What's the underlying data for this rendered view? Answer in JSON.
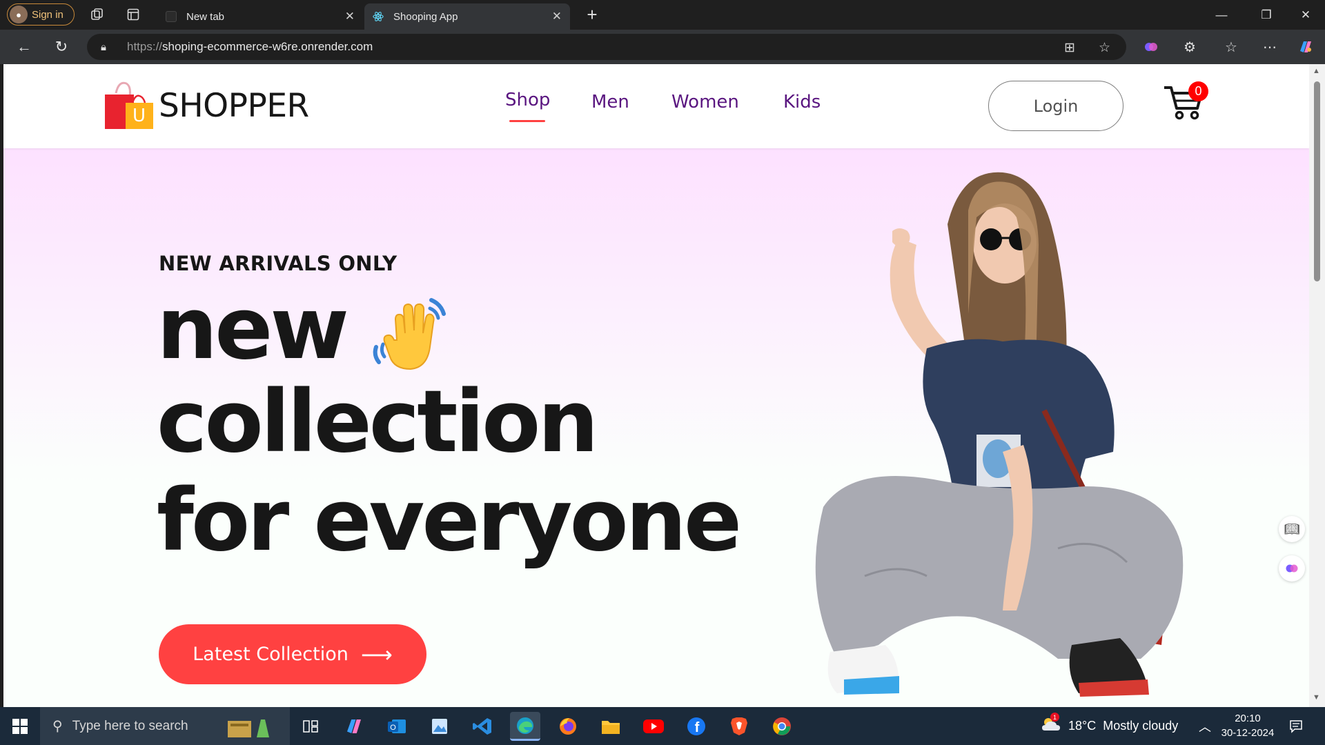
{
  "browser": {
    "signin_label": "Sign in",
    "tabs": [
      {
        "title": "New tab"
      },
      {
        "title": "Shooping App"
      }
    ],
    "url_protocol": "https://",
    "url_host": "shoping-ecommerce-w6re.onrender.com"
  },
  "site": {
    "brand": "SHOPPER",
    "bag_letter": "U",
    "menu": [
      "Shop",
      "Men",
      "Women",
      "Kids"
    ],
    "active_menu": "Shop",
    "login_label": "Login",
    "cart_count": "0",
    "colors": {
      "accent": "#ff4141",
      "menu": "#5a1680",
      "hero_top": "#fde1ff"
    }
  },
  "hero": {
    "eyebrow": "NEW ARRIVALS ONLY",
    "line1": "new",
    "line2": "collection",
    "line3": "for everyone",
    "cta_label": "Latest Collection",
    "cta_icon": "arrow-right-icon",
    "wave_icon": "waving-hand-icon"
  },
  "taskbar": {
    "search_placeholder": "Type here to search",
    "weather_temp": "18°C",
    "weather_text": "Mostly cloudy",
    "weather_badge": "1",
    "time": "20:10",
    "date": "30-12-2024"
  }
}
